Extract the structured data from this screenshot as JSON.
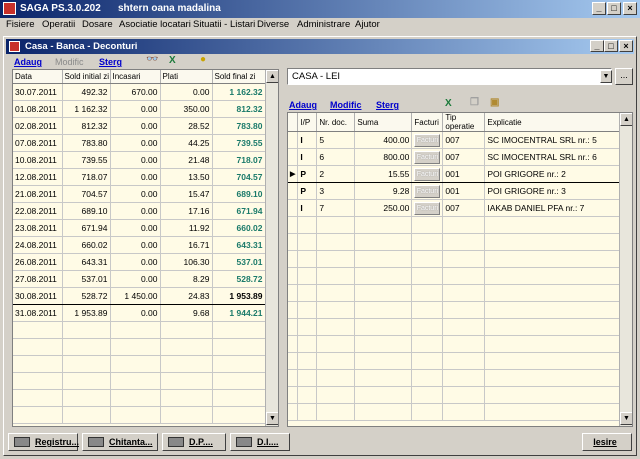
{
  "app": {
    "title": "SAGA PS.3.0.202",
    "user": "shtern oana madalina"
  },
  "menu": [
    "Fisiere",
    "Operatii",
    "Dosare",
    "Asociatie locatari",
    "Situatii - Listari",
    "Diverse",
    "Administrare",
    "Ajutor"
  ],
  "window": {
    "title": "Casa - Banca - Deconturi"
  },
  "left_toolbar": {
    "add": "Adaug",
    "modify": "Modific",
    "delete": "Sterg"
  },
  "left_grid": {
    "columns": [
      "Data",
      "Sold initial zi",
      "Incasari",
      "Plati",
      "Sold final zi"
    ],
    "rows": [
      {
        "date": "30.07.2011",
        "sold_initial": "492.32",
        "incasari": "670.00",
        "plati": "0.00",
        "sold_final": "1 162.32"
      },
      {
        "date": "01.08.2011",
        "sold_initial": "1 162.32",
        "incasari": "0.00",
        "plati": "350.00",
        "sold_final": "812.32"
      },
      {
        "date": "02.08.2011",
        "sold_initial": "812.32",
        "incasari": "0.00",
        "plati": "28.52",
        "sold_final": "783.80"
      },
      {
        "date": "07.08.2011",
        "sold_initial": "783.80",
        "incasari": "0.00",
        "plati": "44.25",
        "sold_final": "739.55"
      },
      {
        "date": "10.08.2011",
        "sold_initial": "739.55",
        "incasari": "0.00",
        "plati": "21.48",
        "sold_final": "718.07"
      },
      {
        "date": "12.08.2011",
        "sold_initial": "718.07",
        "incasari": "0.00",
        "plati": "13.50",
        "sold_final": "704.57"
      },
      {
        "date": "21.08.2011",
        "sold_initial": "704.57",
        "incasari": "0.00",
        "plati": "15.47",
        "sold_final": "689.10"
      },
      {
        "date": "22.08.2011",
        "sold_initial": "689.10",
        "incasari": "0.00",
        "plati": "17.16",
        "sold_final": "671.94"
      },
      {
        "date": "23.08.2011",
        "sold_initial": "671.94",
        "incasari": "0.00",
        "plati": "11.92",
        "sold_final": "660.02"
      },
      {
        "date": "24.08.2011",
        "sold_initial": "660.02",
        "incasari": "0.00",
        "plati": "16.71",
        "sold_final": "643.31"
      },
      {
        "date": "26.08.2011",
        "sold_initial": "643.31",
        "incasari": "0.00",
        "plati": "106.30",
        "sold_final": "537.01"
      },
      {
        "date": "27.08.2011",
        "sold_initial": "537.01",
        "incasari": "0.00",
        "plati": "8.29",
        "sold_final": "528.72"
      },
      {
        "date": "30.08.2011",
        "sold_initial": "528.72",
        "incasari": "1 450.00",
        "plati": "24.83",
        "sold_final": "1 953.89"
      },
      {
        "date": "31.08.2011",
        "sold_initial": "1 953.89",
        "incasari": "0.00",
        "plati": "9.68",
        "sold_final": "1 944.21"
      }
    ]
  },
  "account_select": {
    "value": "CASA - LEI"
  },
  "right_toolbar": {
    "add": "Adaug",
    "modify": "Modific",
    "delete": "Sterg"
  },
  "right_grid": {
    "columns": [
      "I/P",
      "Nr. doc.",
      "Suma",
      "Facturi",
      "Tip operatie",
      "Explicatie"
    ],
    "rows": [
      {
        "ip": "I",
        "nr_doc": "5",
        "suma": "400.00",
        "facturi": "Facturi",
        "tip": "007",
        "explicatie": "SC IMOCENTRAL SRL nr.: 5"
      },
      {
        "ip": "I",
        "nr_doc": "6",
        "suma": "800.00",
        "facturi": "Facturi",
        "tip": "007",
        "explicatie": "SC IMOCENTRAL SRL nr.: 6"
      },
      {
        "ip": "P",
        "nr_doc": "2",
        "suma": "15.55",
        "facturi": "Facturi",
        "tip": "001",
        "explicatie": "POI GRIGORE nr.: 2"
      },
      {
        "ip": "P",
        "nr_doc": "3",
        "suma": "9.28",
        "facturi": "Facturi",
        "tip": "001",
        "explicatie": "POI GRIGORE nr.: 3"
      },
      {
        "ip": "I",
        "nr_doc": "7",
        "suma": "250.00",
        "facturi": "Facturi",
        "tip": "007",
        "explicatie": "IAKAB DANIEL PFA nr.: 7"
      }
    ]
  },
  "bottom": {
    "registru": "Registru...",
    "chitanta": "Chitanta...",
    "dp": "D.P....",
    "di": "D.I....",
    "exit": "Iesire"
  }
}
